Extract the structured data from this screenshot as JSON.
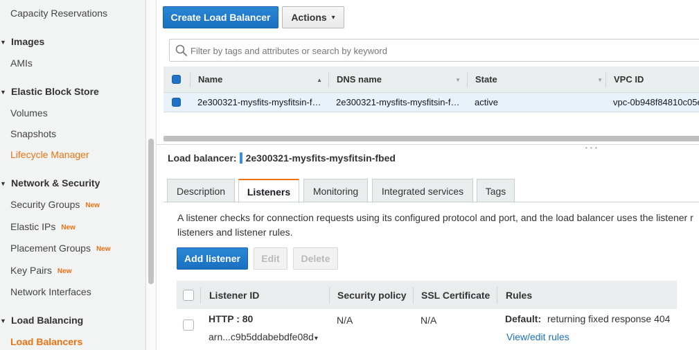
{
  "sidebar": {
    "items": [
      {
        "label": "Capacity Reservations",
        "type": "item",
        "new": ""
      },
      {
        "label": "Images",
        "type": "group",
        "new": ""
      },
      {
        "label": "AMIs",
        "type": "item",
        "new": ""
      },
      {
        "label": "Elastic Block Store",
        "type": "group",
        "new": ""
      },
      {
        "label": "Volumes",
        "type": "item",
        "new": ""
      },
      {
        "label": "Snapshots",
        "type": "item",
        "new": ""
      },
      {
        "label": "Lifecycle Manager",
        "type": "item",
        "new": ""
      },
      {
        "label": "Network & Security",
        "type": "group",
        "new": ""
      },
      {
        "label": "Security Groups",
        "type": "item",
        "new": "New"
      },
      {
        "label": "Elastic IPs",
        "type": "item",
        "new": "New"
      },
      {
        "label": "Placement Groups",
        "type": "item",
        "new": "New"
      },
      {
        "label": "Key Pairs",
        "type": "item",
        "new": "New"
      },
      {
        "label": "Network Interfaces",
        "type": "item",
        "new": ""
      },
      {
        "label": "Load Balancing",
        "type": "group",
        "new": ""
      },
      {
        "label": "Load Balancers",
        "type": "item",
        "new": ""
      }
    ]
  },
  "toolbar": {
    "create_label": "Create Load Balancer",
    "actions_label": "Actions",
    "actions_caret": "▾"
  },
  "search": {
    "placeholder": "Filter by tags and attributes or search by keyword",
    "value": ""
  },
  "table": {
    "columns": [
      "Name",
      "DNS name",
      "State",
      "VPC ID"
    ],
    "rows": [
      {
        "name": "2e300321-mysfits-mysfitsin-f…",
        "dns": "2e300321-mysfits-mysfitsin-f…",
        "state": "active",
        "vpc": "vpc-0b948f84810c05e"
      }
    ]
  },
  "details": {
    "label_prefix": "Load balancer:",
    "label_value": "2e300321-mysfits-mysfitsin-fbed",
    "tabs": [
      "Description",
      "Listeners",
      "Monitoring",
      "Integrated services",
      "Tags"
    ],
    "active_tab": "Listeners",
    "description_line1": "A listener checks for connection requests using its configured protocol and port, and the load balancer uses the listener r",
    "description_line2": "listeners and listener rules."
  },
  "listeners": {
    "add_label": "Add listener",
    "edit_label": "Edit",
    "delete_label": "Delete",
    "columns": [
      "Listener ID",
      "Security policy",
      "SSL Certificate",
      "Rules"
    ],
    "rows": [
      {
        "id": "HTTP : 80",
        "arn": "arn...c9b5ddabebdfe08d",
        "arn_caret": "▾",
        "security_policy": "N/A",
        "ssl_certificate": "N/A",
        "rule_default_label": "Default:",
        "rule_default_text": "returning fixed response 404",
        "rule_link": "View/edit rules"
      }
    ]
  },
  "colors": {
    "accent": "#ec7211",
    "primary_button": "#1a6fc0",
    "selected_row": "#e9f1fb",
    "header_bg": "#eaeded"
  }
}
